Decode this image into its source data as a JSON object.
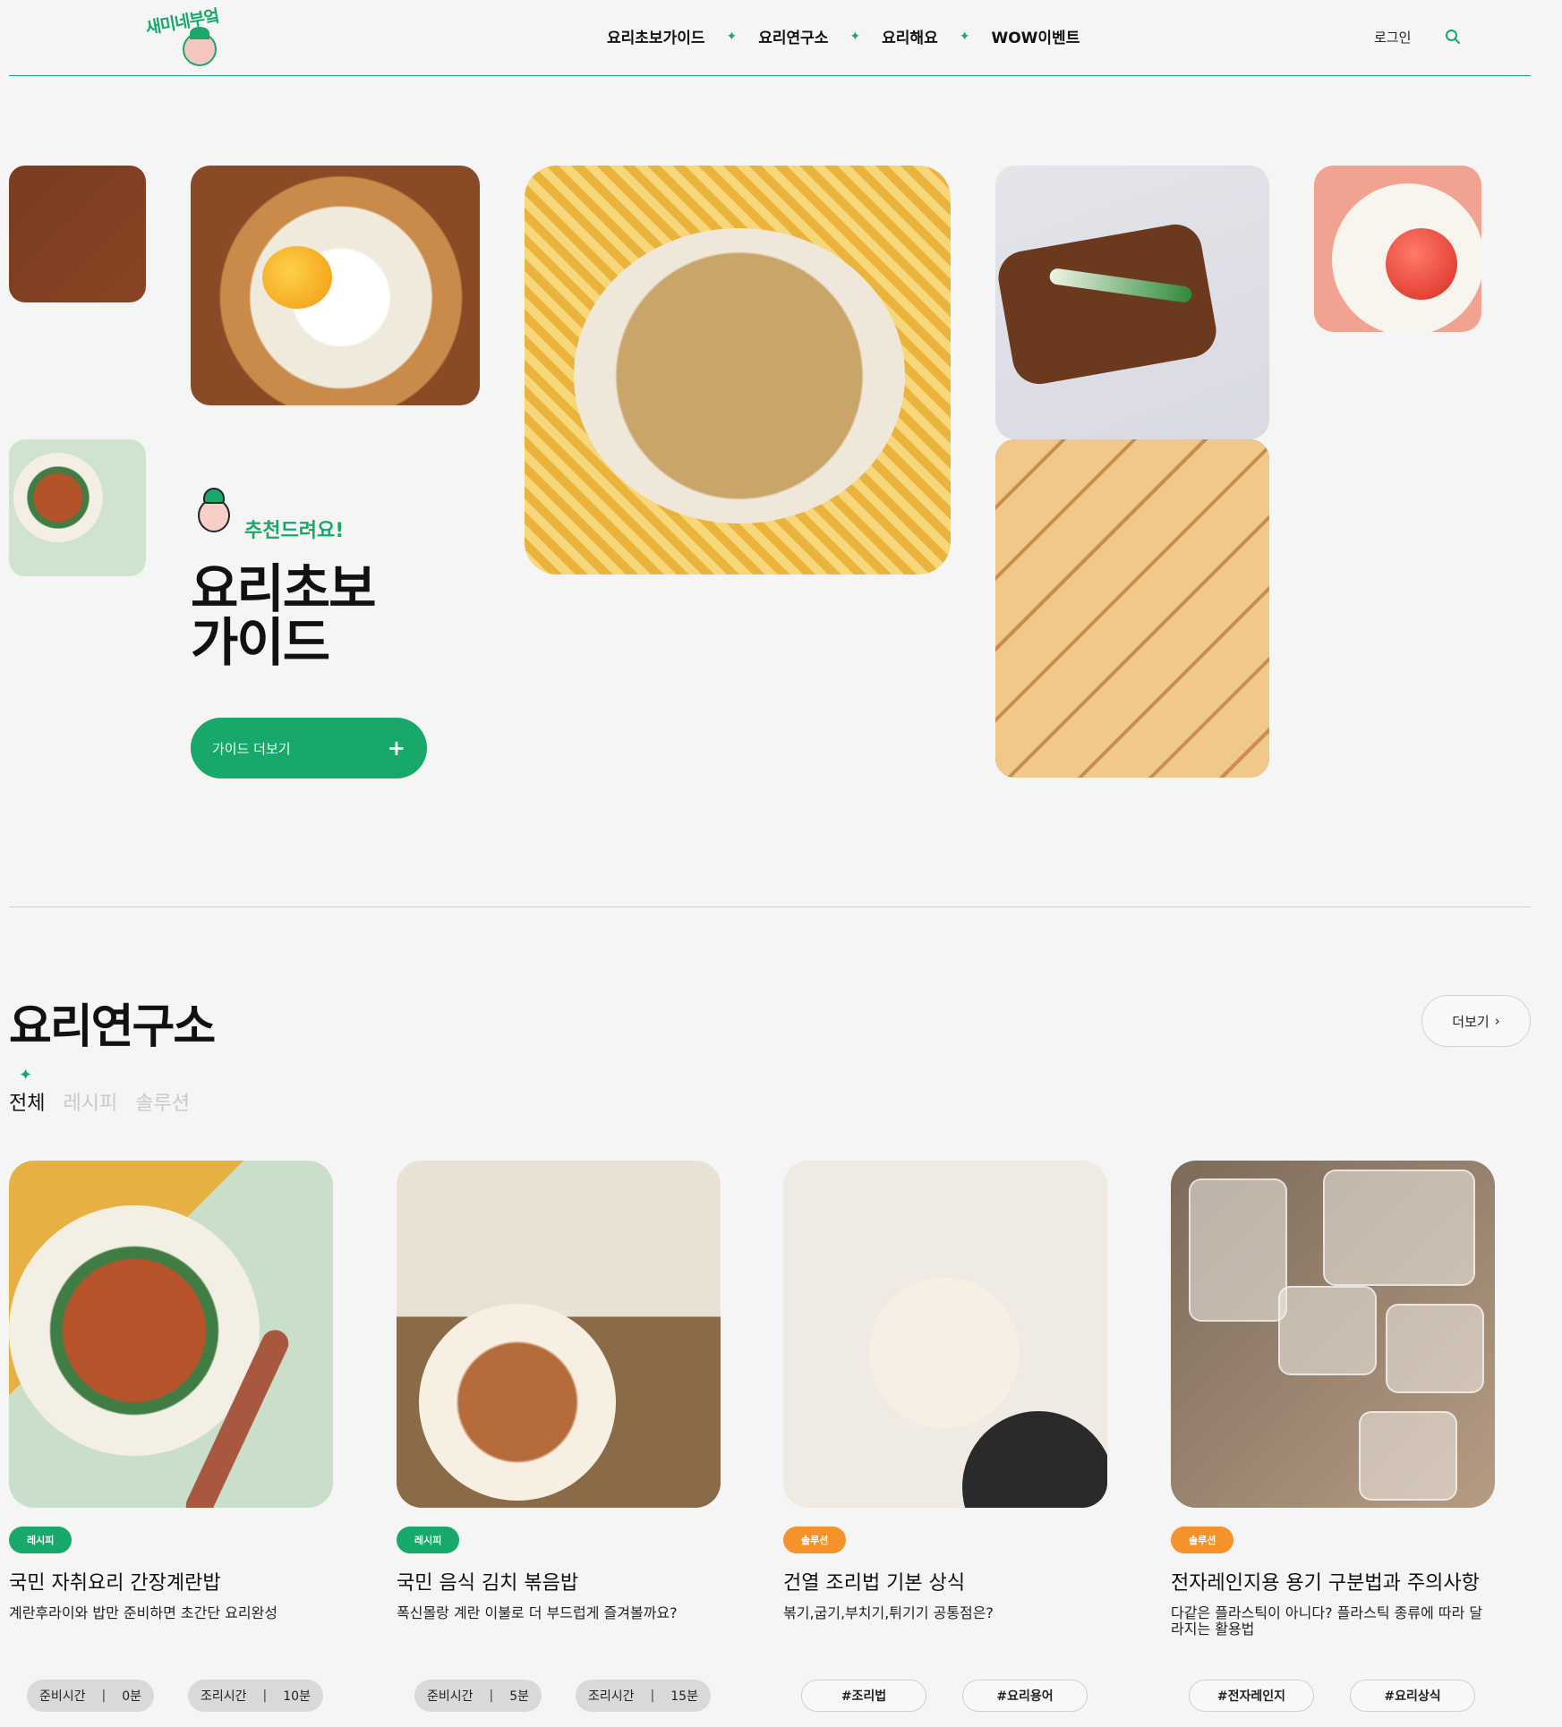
{
  "header": {
    "logo_text": "새미네부엌",
    "nav": [
      "요리초보가이드",
      "요리연구소",
      "요리해요",
      "WOW이벤트"
    ],
    "nav_separator": "✦",
    "login": "로그인",
    "search_icon": "search-icon"
  },
  "hero": {
    "recommend": "추천드려요!",
    "title": "요리초보 가이드",
    "guide_button": "가이드 더보기",
    "guide_button_icon": "+"
  },
  "lab": {
    "title": "요리연구소",
    "more_button": "더보기",
    "more_icon": "›",
    "tab_marker": "✦",
    "tabs": [
      "전체",
      "레시피",
      "솔루션"
    ],
    "active_tab": "전체",
    "cards": [
      {
        "badge": "레시피",
        "title": "국민 자취요리 간장계란밥",
        "desc": "계란후라이와 밥만 준비하면 초간단 요리완성",
        "prep_label": "준비시간",
        "prep_value": "0분",
        "cook_label": "조리시간",
        "cook_value": "10분"
      },
      {
        "badge": "레시피",
        "title": "국민 음식 김치 볶음밥",
        "desc": "폭신몰랑 계란 이불로 더 부드럽게 즐겨볼까요?",
        "prep_label": "준비시간",
        "prep_value": "5분",
        "cook_label": "조리시간",
        "cook_value": "15분"
      },
      {
        "badge": "솔루션",
        "title": "건열 조리법 기본 상식",
        "desc": "볶기,굽기,부치기,튀기기 공통점은?",
        "tags": [
          "#조리법",
          "#요리용어"
        ]
      },
      {
        "badge": "솔루션",
        "title": "전자레인지용 용기 구분법과 주의사항",
        "desc": "다같은 플라스틱이 아니다? 플라스틱 종류에 따라 달라지는 활용법",
        "tags": [
          "#전자레인지",
          "#요리상식"
        ]
      }
    ]
  },
  "colors": {
    "accent": "#17a86a",
    "solution": "#f5922a",
    "background": "#f5f5f5"
  }
}
